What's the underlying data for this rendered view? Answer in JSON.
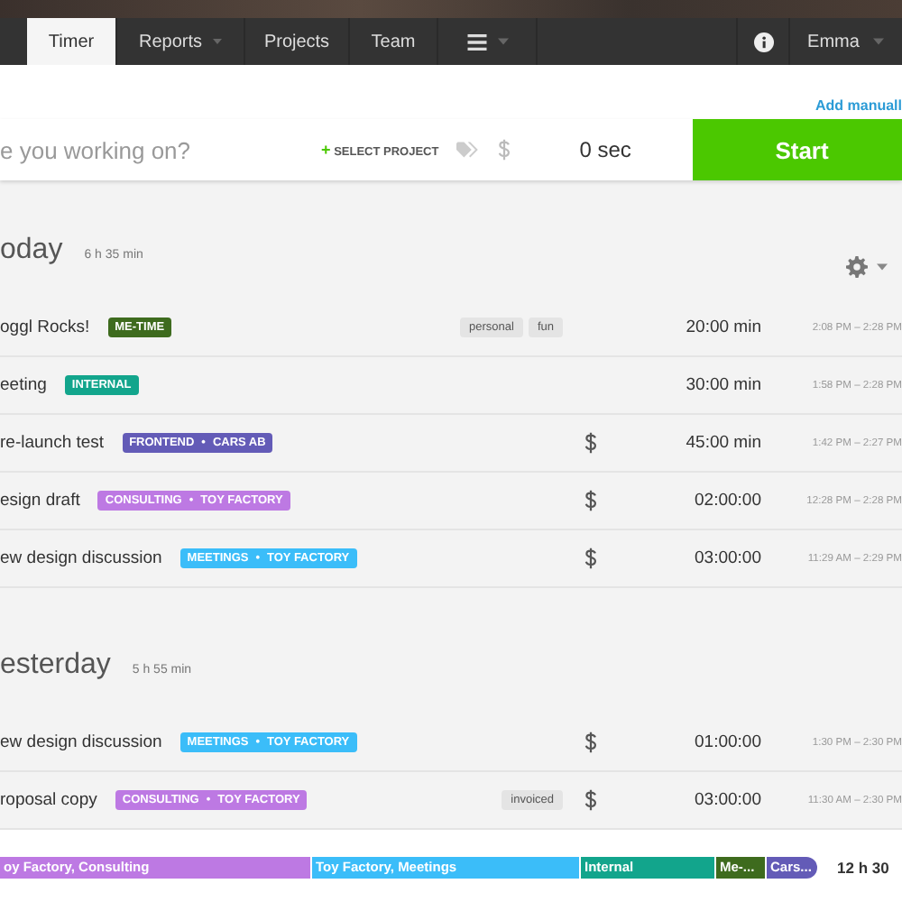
{
  "nav": {
    "tabs": [
      {
        "kind": "text",
        "label": "Timer",
        "selected": true,
        "dropdown": false
      },
      {
        "kind": "text",
        "label": "Reports",
        "selected": false,
        "dropdown": true
      },
      {
        "kind": "text",
        "label": "Projects",
        "selected": false,
        "dropdown": false
      },
      {
        "kind": "text",
        "label": "Team",
        "selected": false,
        "dropdown": false
      },
      {
        "kind": "menu",
        "selected": false,
        "dropdown": true
      }
    ],
    "user": {
      "name": "Emma",
      "dropdown": true
    }
  },
  "add_manually": "Add manuall",
  "timer": {
    "placeholder": "e you working on?",
    "select_project": "SELECT PROJECT",
    "plus": "+",
    "duration": "0 sec",
    "start": "Start"
  },
  "days": [
    {
      "title": "oday",
      "total": "6 h 35 min",
      "settings": true,
      "entries": [
        {
          "description": "oggl Rocks!",
          "project": "ME-TIME",
          "color": "#3e6b1e",
          "tags": [
            "personal",
            "fun"
          ],
          "billable": false,
          "duration": "20:00 min",
          "range": "2:08 PM – 2:28 PM"
        },
        {
          "description": "eeting",
          "project": "INTERNAL",
          "color": "#12a58c",
          "billable": false,
          "duration": "30:00 min",
          "range": "1:58 PM – 2:28 PM"
        },
        {
          "description": "re-launch test",
          "project": "FRONTEND",
          "separator": "•",
          "client": "CARS AB",
          "color": "#635bb7",
          "billable": true,
          "duration": "45:00 min",
          "range": "1:42 PM – 2:27 PM"
        },
        {
          "description": "esign draft",
          "project": "CONSULTING",
          "separator": "•",
          "client": "TOY FACTORY",
          "color": "#bd79e3",
          "billable": true,
          "duration": "02:00:00",
          "range": "12:28 PM – 2:28 PM"
        },
        {
          "description": "ew design discussion",
          "project": "MEETINGS",
          "separator": "•",
          "client": "TOY FACTORY",
          "color": "#3bbdf9",
          "billable": true,
          "duration": "03:00:00",
          "range": "11:29 AM – 2:29 PM"
        }
      ]
    },
    {
      "title": "esterday",
      "total": "5 h 55 min",
      "settings": false,
      "entries": [
        {
          "description": "ew design discussion",
          "project": "MEETINGS",
          "separator": "•",
          "client": "TOY FACTORY",
          "color": "#3bbdf9",
          "billable": true,
          "duration": "01:00:00",
          "range": "1:30 PM – 2:30 PM"
        },
        {
          "description": "roposal copy",
          "project": "CONSULTING",
          "separator": "•",
          "client": "TOY FACTORY",
          "color": "#bd79e3",
          "tags": [
            "invoiced"
          ],
          "billable": true,
          "duration": "03:00:00",
          "range": "11:30 AM – 2:30 PM"
        }
      ]
    }
  ],
  "summary": {
    "segments": [
      {
        "label": "oy Factory, Consulting",
        "color": "#bd79e3"
      },
      {
        "label": "Toy Factory, Meetings",
        "color": "#3bbdf9"
      },
      {
        "label": "Internal",
        "color": "#12a58c"
      },
      {
        "label": "Me-...",
        "color": "#3e6b1e"
      },
      {
        "label": "Cars...",
        "color": "#635bb7"
      }
    ],
    "total": "12 h 30"
  }
}
